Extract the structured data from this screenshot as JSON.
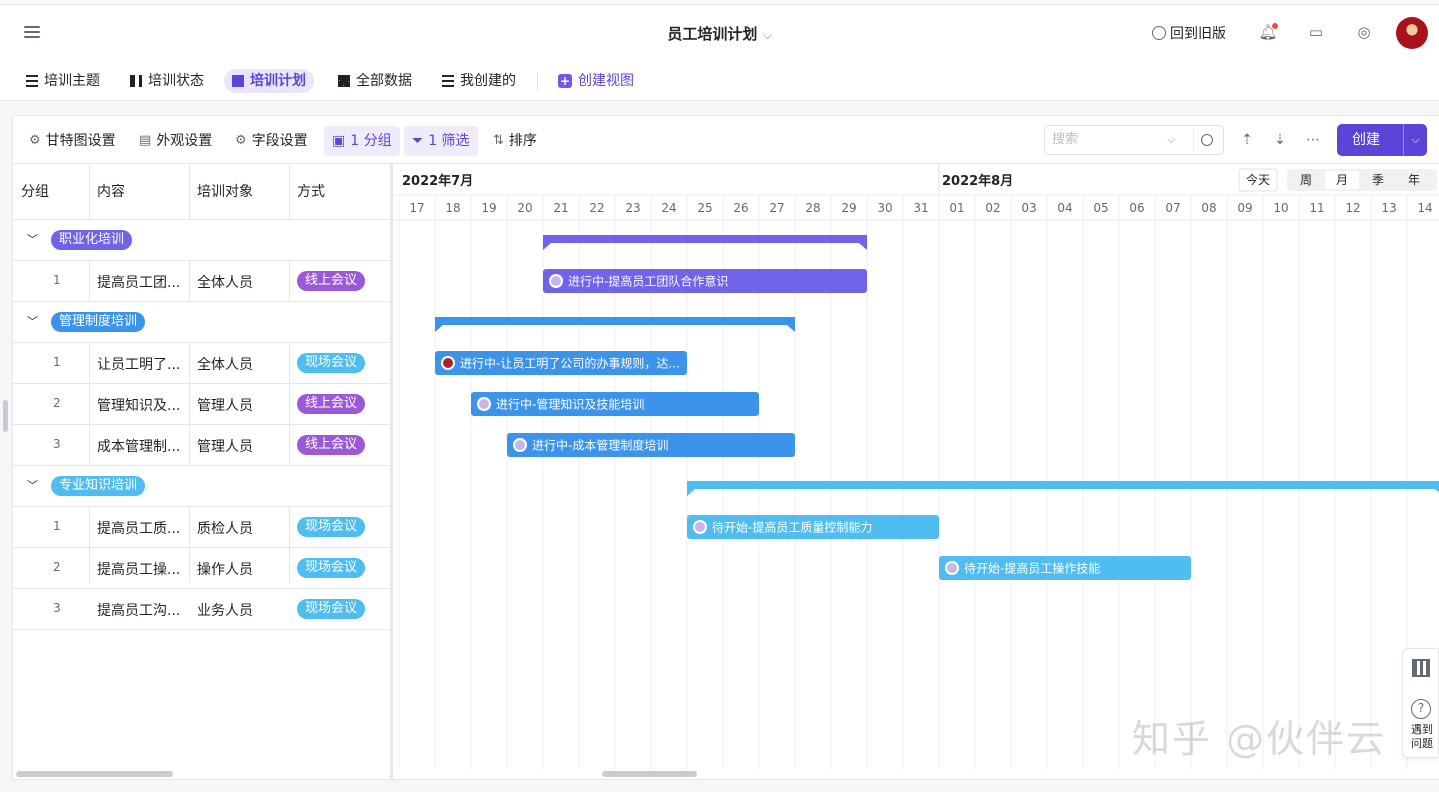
{
  "header": {
    "title": "员工培训计划",
    "old_version": "回到旧版",
    "icons": [
      "menu-icon",
      "bell-icon",
      "briefcase-icon",
      "compass-icon"
    ]
  },
  "tabs": [
    {
      "label": "培训主题",
      "icon": "list-icon"
    },
    {
      "label": "培训状态",
      "icon": "kanban-icon"
    },
    {
      "label": "培训计划",
      "icon": "gantt-icon",
      "active": true
    },
    {
      "label": "全部数据",
      "icon": "grid-icon"
    },
    {
      "label": "我创建的",
      "icon": "list-icon"
    },
    {
      "label": "创建视图",
      "icon": "plus-icon"
    }
  ],
  "toolbar": {
    "gantt_settings": "甘特图设置",
    "appearance": "外观设置",
    "fields": "字段设置",
    "group": "1 分组",
    "filter": "1 筛选",
    "sort": "排序",
    "search_placeholder": "搜索",
    "create": "创建"
  },
  "columns": [
    "分组",
    "内容",
    "培训对象",
    "方式"
  ],
  "groups": [
    {
      "name": "职业化培训",
      "color": "#6e63e9",
      "rows": [
        {
          "no": "1",
          "content": "提高员工团...",
          "target": "全体人员",
          "mode": "线上会议"
        }
      ]
    },
    {
      "name": "管理制度培训",
      "color": "#3c93ea",
      "rows": [
        {
          "no": "1",
          "content": "让员工明了...",
          "target": "全体人员",
          "mode": "现场会议"
        },
        {
          "no": "2",
          "content": "管理知识及...",
          "target": "管理人员",
          "mode": "线上会议"
        },
        {
          "no": "3",
          "content": "成本管理制...",
          "target": "管理人员",
          "mode": "线上会议"
        }
      ]
    },
    {
      "name": "专业知识培训",
      "color": "#4fbdf0",
      "rows": [
        {
          "no": "1",
          "content": "提高员工质...",
          "target": "质检人员",
          "mode": "现场会议"
        },
        {
          "no": "2",
          "content": "提高员工操...",
          "target": "操作人员",
          "mode": "现场会议"
        },
        {
          "no": "3",
          "content": "提高员工沟...",
          "target": "业务人员",
          "mode": "现场会议"
        }
      ]
    }
  ],
  "mode_colors": {
    "线上会议": "#9b59d6",
    "现场会议": "#4fbdf0"
  },
  "timeline": {
    "months": [
      {
        "label": "2022年7月",
        "first_day": "17"
      },
      {
        "label": "2022年8月",
        "first_day": "01"
      }
    ],
    "days": [
      "17",
      "18",
      "19",
      "20",
      "21",
      "22",
      "23",
      "24",
      "25",
      "26",
      "27",
      "28",
      "29",
      "30",
      "31",
      "01",
      "02",
      "03",
      "04",
      "05",
      "06",
      "07",
      "08",
      "09",
      "10",
      "11",
      "12",
      "13",
      "14"
    ],
    "today": "今天",
    "scales": [
      "周",
      "月",
      "季",
      "年"
    ],
    "active_scale": "月"
  },
  "summary_bars": [
    {
      "group": "职业化培训",
      "start": "07-21",
      "end": "07-29",
      "color": "#6e63e9"
    },
    {
      "group": "管理制度培训",
      "start": "07-18",
      "end": "07-27",
      "color": "#3c93ea"
    },
    {
      "group": "专业知识培训",
      "start": "07-25",
      "end": "08-14",
      "color": "#4fbdf0"
    }
  ],
  "task_bars": [
    {
      "label": "进行中-提高员工团队合作意识",
      "start": "07-21",
      "end": "07-29",
      "color": "#6e63e9"
    },
    {
      "label": "进行中-让员工明了公司的办事规则，达...",
      "start": "07-18",
      "end": "07-24",
      "color": "#3c93ea"
    },
    {
      "label": "进行中-管理知识及技能培训",
      "start": "07-19",
      "end": "07-26",
      "color": "#3c93ea"
    },
    {
      "label": "进行中-成本管理制度培训",
      "start": "07-20",
      "end": "07-27",
      "color": "#3c93ea"
    },
    {
      "label": "待开始-提高员工质量控制能力",
      "start": "07-25",
      "end": "07-31",
      "color": "#4fbdf0"
    },
    {
      "label": "待开始-提高员工操作技能",
      "start": "08-01",
      "end": "08-07",
      "color": "#4fbdf0"
    }
  ],
  "help": {
    "text": "遇到问题"
  },
  "watermark": "知乎 @伙伴云"
}
